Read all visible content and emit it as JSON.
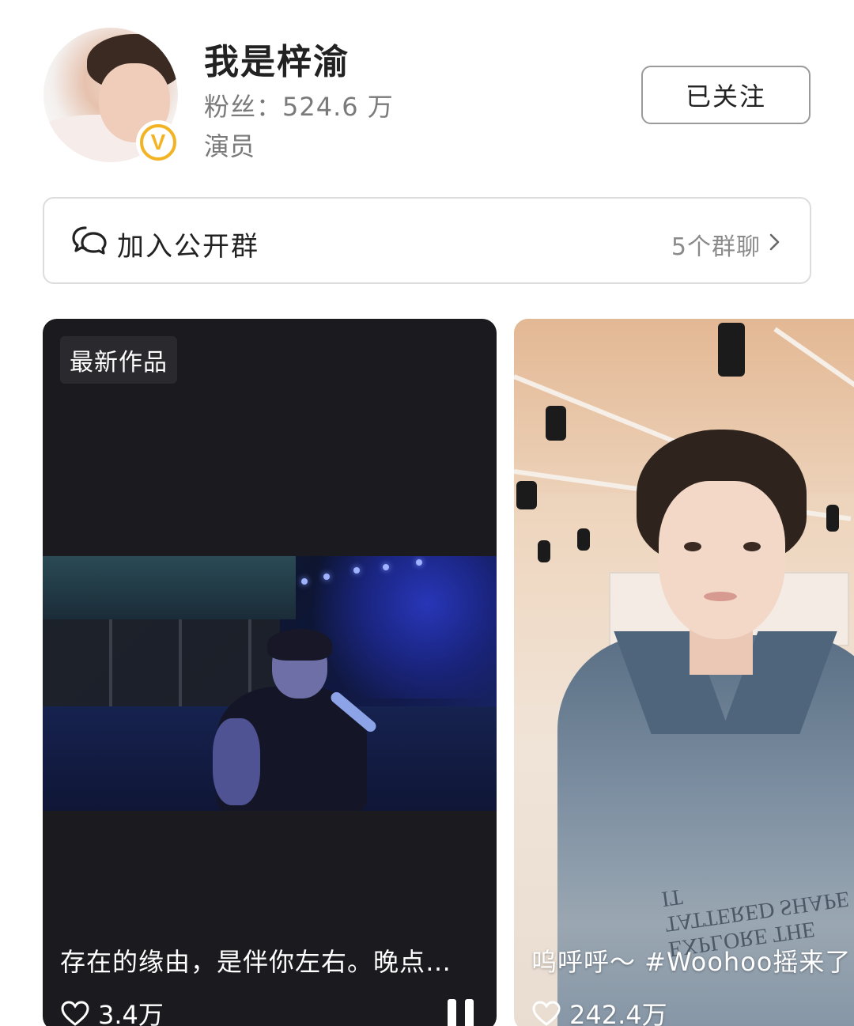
{
  "profile": {
    "username": "我是梓渝",
    "fans": "粉丝：524.6 万",
    "profession": "演员",
    "badge": "V",
    "follow_button": "已关注"
  },
  "group_chat": {
    "label": "加入公开群",
    "count": "5个群聊"
  },
  "cards": [
    {
      "tag": "最新作品",
      "caption": "存在的缘由，是伴你左右。晚点…",
      "likes": "3.4万"
    },
    {
      "caption": "呜呼呼～ #Woohoo摇来了",
      "likes": "242.4万",
      "shirt_text": "EXPLORE THE TATTERED SHAPE IT"
    }
  ],
  "colors": {
    "verified_badge": "#f2b424",
    "card_dark": "#1b1a1f"
  }
}
